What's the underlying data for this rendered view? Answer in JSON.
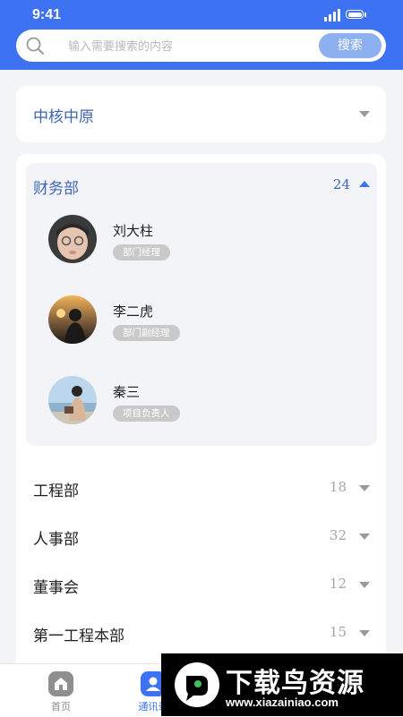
{
  "status_bar": {
    "time": "9:41"
  },
  "search": {
    "placeholder": "输入需要搜索的内容",
    "button_label": "搜索"
  },
  "company": {
    "name": "中核中原"
  },
  "expanded_department": {
    "name": "财务部",
    "count": "24",
    "members": [
      {
        "name": "刘大柱",
        "role": "部门经理"
      },
      {
        "name": "李二虎",
        "role": "部门副经理"
      },
      {
        "name": "秦三",
        "role": "项目负责人"
      }
    ]
  },
  "departments": [
    {
      "name": "工程部",
      "count": "18"
    },
    {
      "name": "人事部",
      "count": "32"
    },
    {
      "name": "董事会",
      "count": "12"
    },
    {
      "name": "第一工程本部",
      "count": "15"
    }
  ],
  "tabbar": {
    "tabs": [
      {
        "label": "首页",
        "icon": "home-icon"
      },
      {
        "label": "通讯录",
        "icon": "contacts-icon"
      }
    ]
  },
  "watermark": {
    "title": "下载鸟资源",
    "url": "www.xiazainiao.com"
  },
  "colors": {
    "primary": "#3d72f2",
    "accent_text": "#3f64b6",
    "background": "#f3f4f6",
    "role_badge": "#c9c9c9"
  }
}
